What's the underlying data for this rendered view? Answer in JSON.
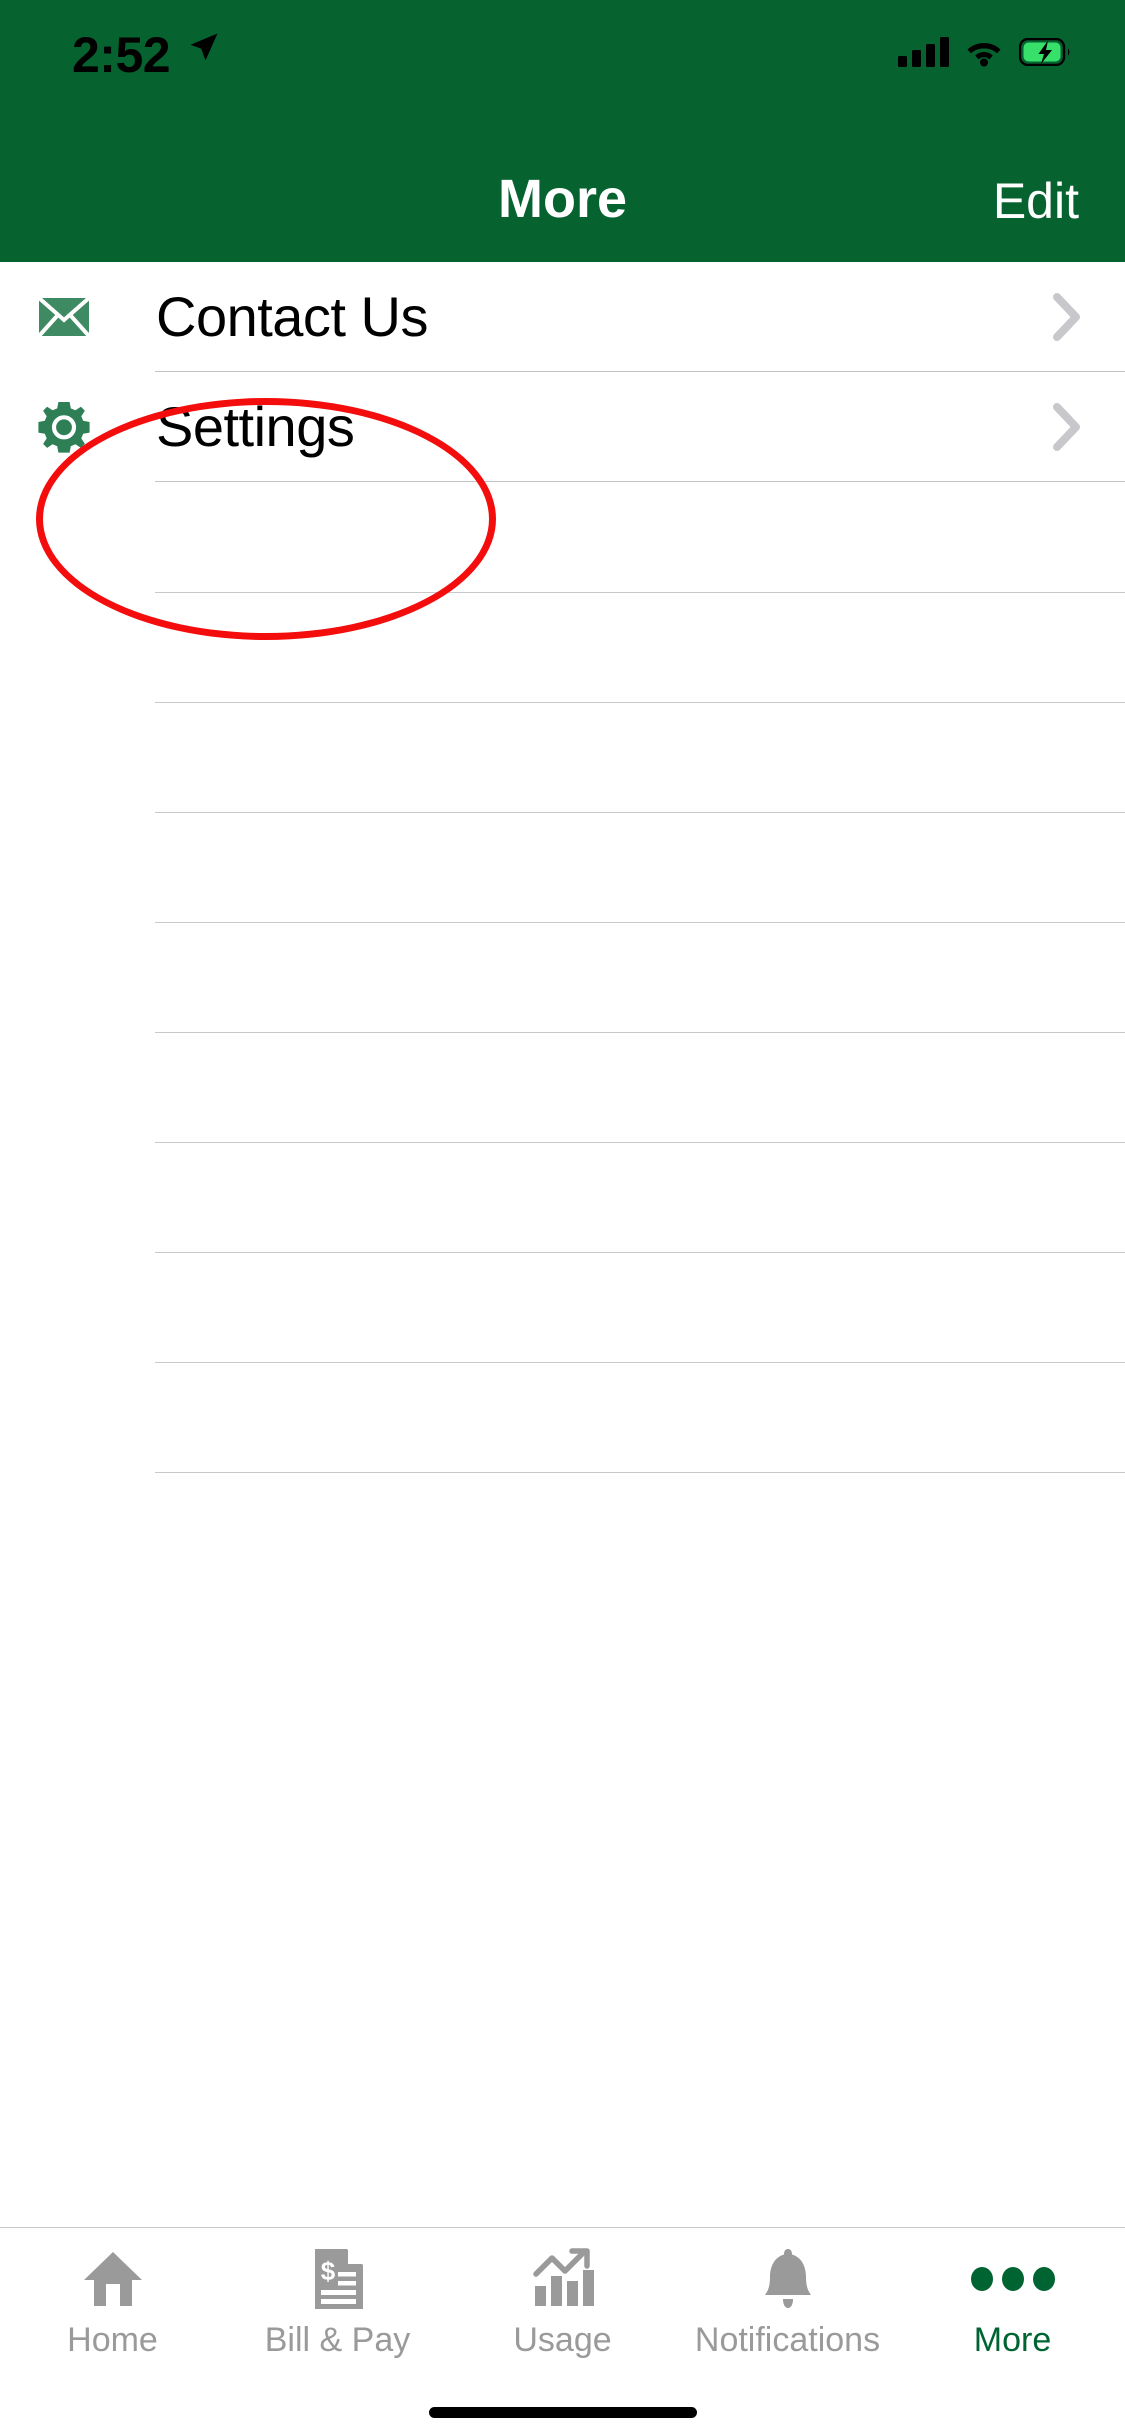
{
  "statusbar": {
    "time": "2:52",
    "location_icon": "location-arrow-icon",
    "cellular_icon": "cellular-signal-icon",
    "wifi_icon": "wifi-icon",
    "battery_icon": "battery-charging-icon"
  },
  "header": {
    "title": "More",
    "edit_label": "Edit",
    "background_color": "#066330",
    "title_color": "#ffffff"
  },
  "list": {
    "rows": [
      {
        "label": "Contact Us",
        "icon": "envelope-icon",
        "chevron": "chevron-right-icon"
      },
      {
        "label": "Settings",
        "icon": "gear-icon",
        "chevron": "chevron-right-icon"
      }
    ],
    "empty_separator_count": 9,
    "separator_color": "#c6c6c8",
    "icon_color": "#3d8a63"
  },
  "annotation": {
    "shape": "ellipse",
    "color": "#f40d0d",
    "targets": "Settings"
  },
  "tabbar": {
    "items": [
      {
        "label": "Home",
        "icon": "home-icon",
        "active": false
      },
      {
        "label": "Bill & Pay",
        "icon": "invoice-dollar-icon",
        "active": false
      },
      {
        "label": "Usage",
        "icon": "bar-chart-arrow-icon",
        "active": false
      },
      {
        "label": "Notifications",
        "icon": "bell-icon",
        "active": false
      },
      {
        "label": "More",
        "icon": "ellipsis-icon",
        "active": true
      }
    ],
    "inactive_color": "#9a9a9a",
    "active_color": "#006432"
  },
  "home_indicator": "home-indicator-bar"
}
